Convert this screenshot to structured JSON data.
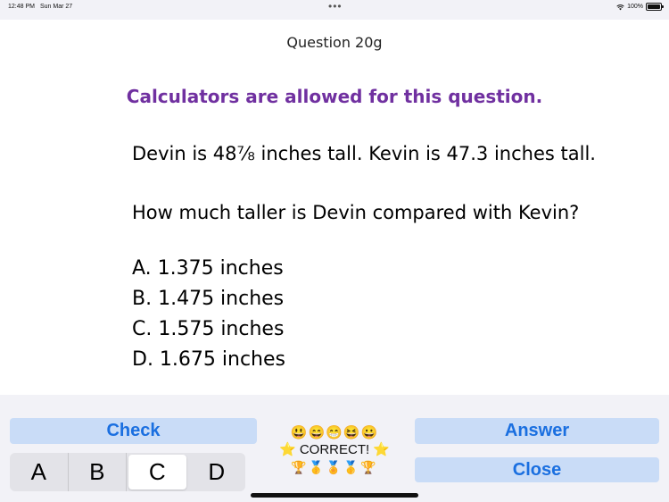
{
  "status_bar": {
    "time": "12:48 PM",
    "date": "Sun Mar 27",
    "dots": "•••",
    "battery": "100%"
  },
  "question": {
    "number": "Question 20g",
    "calculator_note": "Calculators are allowed for this question.",
    "stem_line1": "Devin is 48⅞ inches tall. Kevin is 47.3 inches tall.",
    "stem_line2": "How much taller is Devin compared with Kevin?",
    "choices": [
      "A. 1.375 inches",
      "B. 1.475 inches",
      "C. 1.575 inches",
      "D. 1.675 inches"
    ]
  },
  "controls": {
    "check_label": "Check",
    "answer_label": "Answer",
    "close_label": "Close",
    "options": [
      "A",
      "B",
      "C",
      "D"
    ],
    "selected_option": "C"
  },
  "feedback": {
    "emojis": "😃😄😁😆😀",
    "correct_line": "⭐ CORRECT! ⭐",
    "awards": "🏆🥇🏅🥇🏆"
  },
  "colors": {
    "calculator_note": "#7030a0",
    "button_bg": "#c9dcf7",
    "button_text": "#1a6fe0"
  }
}
